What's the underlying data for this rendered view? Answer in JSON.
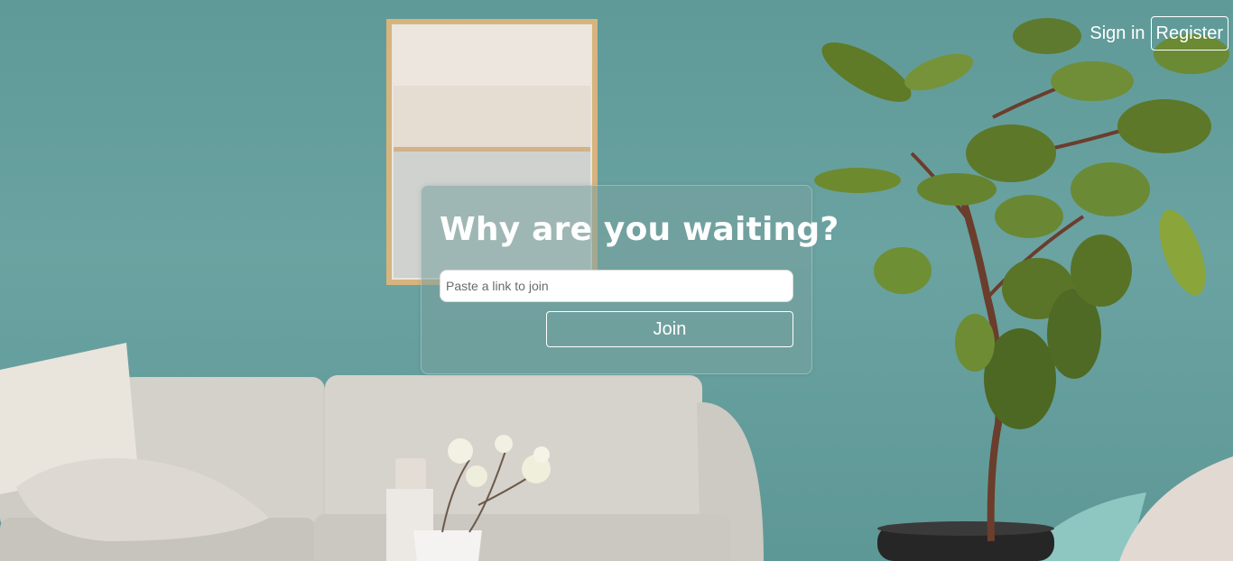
{
  "nav": {
    "sign_in_label": "Sign in",
    "register_label": "Register"
  },
  "join_card": {
    "title": "Why are you waiting?",
    "input_placeholder": "Paste a link to join",
    "input_value": "",
    "join_label": "Join"
  },
  "colors": {
    "wall": "#5f9a98",
    "sofa": "#d9d6d0",
    "leaf": "#5e7a2e",
    "frame": "#d6b27a"
  }
}
